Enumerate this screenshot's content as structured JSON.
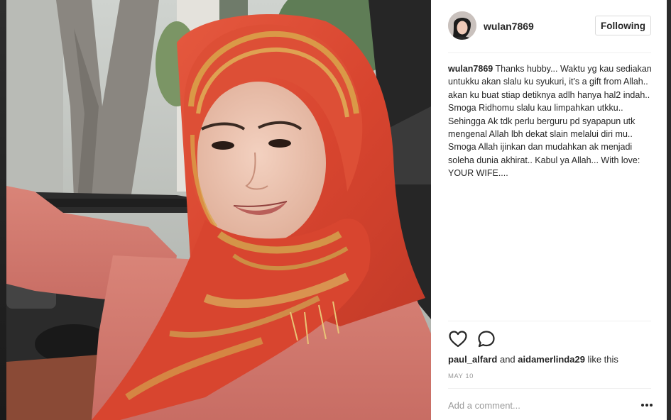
{
  "post": {
    "username": "wulan7869",
    "follow_label": "Following",
    "caption": {
      "username": "wulan7869",
      "text": "Thanks hubby... Waktu yg kau sediakan untukku akan slalu ku syukuri, it's a gift from Allah.. akan ku buat stiap detiknya adlh hanya hal2 indah.. Smoga Ridhomu slalu kau limpahkan utkku.. Sehingga Ak tdk perlu berguru pd syapapun utk mengenal Allah lbh dekat slain melalui diri mu.. Smoga Allah ijinkan dan mudahkan ak menjadi soleha dunia akhirat.. Kabul ya Allah... With love: YOUR WIFE...."
    },
    "likes": {
      "user1": "paul_alfard",
      "connector": " and ",
      "user2": "aidamerlinda29",
      "suffix": " like this"
    },
    "date": "MAY 10",
    "comment_placeholder": "Add a comment...",
    "icons": {
      "like": "heart-icon",
      "comment": "comment-bubble-icon",
      "more": "more-options-icon"
    }
  },
  "colors": {
    "text": "#262626",
    "muted": "#999999",
    "divider": "#efefef",
    "button_border": "#dbdbdb"
  }
}
